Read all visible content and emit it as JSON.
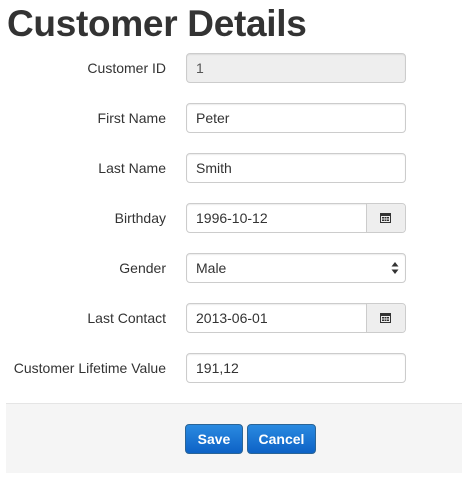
{
  "page_title": "Customer Details",
  "form": {
    "customer_id": {
      "label": "Customer ID",
      "value": "1"
    },
    "first_name": {
      "label": "First Name",
      "value": "Peter"
    },
    "last_name": {
      "label": "Last Name",
      "value": "Smith"
    },
    "birthday": {
      "label": "Birthday",
      "value": "1996-10-12",
      "icon": "calendar-icon"
    },
    "gender": {
      "label": "Gender",
      "value": "Male",
      "icon": "select-arrows-icon"
    },
    "last_contact": {
      "label": "Last Contact",
      "value": "2013-06-01",
      "icon": "calendar-icon"
    },
    "lifetime_value": {
      "label": "Customer Lifetime Value",
      "value": "191,12"
    }
  },
  "footer": {
    "save_label": "Save",
    "cancel_label": "Cancel"
  },
  "colors": {
    "button_primary": "#0d62c6",
    "footer_background": "#f5f5f5",
    "disabled_field": "#eeeeee"
  }
}
